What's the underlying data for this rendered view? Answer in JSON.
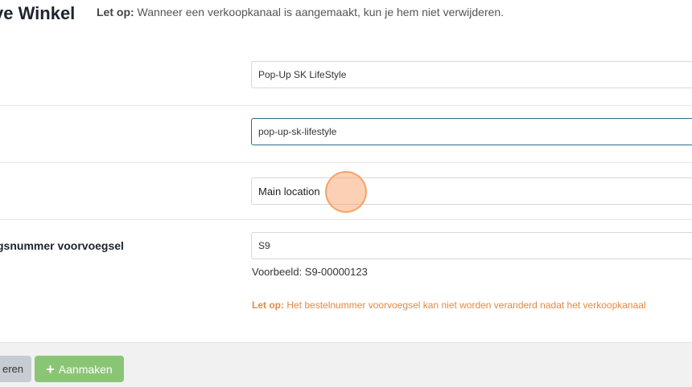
{
  "header": {
    "title": "ve Winkel",
    "notice_prefix": "Let op:",
    "notice_text": "Wanneer een verkoopkanaal is aangemaakt, kun je hem niet verwijderen."
  },
  "form": {
    "name_value": "Pop-Up SK LifeStyle",
    "slug_value": "pop-up-sk-lifestyle",
    "location_value": "Main location",
    "prefix_label": "gsnummer voorvoegsel",
    "prefix_value": "S9",
    "example_text": "Voorbeeld: S9-00000123",
    "warning_prefix": "Let op:",
    "warning_text": "Het bestelnummer voorvoegsel kan niet worden veranderd nadat het verkoopkanaal"
  },
  "footer": {
    "cancel_label": "eren",
    "create_label": "Aanmaken",
    "create_icon": "plus-icon"
  },
  "colors": {
    "accent_green": "#8ac576",
    "focus_border": "#2a6f83",
    "warning": "#e08a47",
    "cursor": "#f9a66c"
  }
}
